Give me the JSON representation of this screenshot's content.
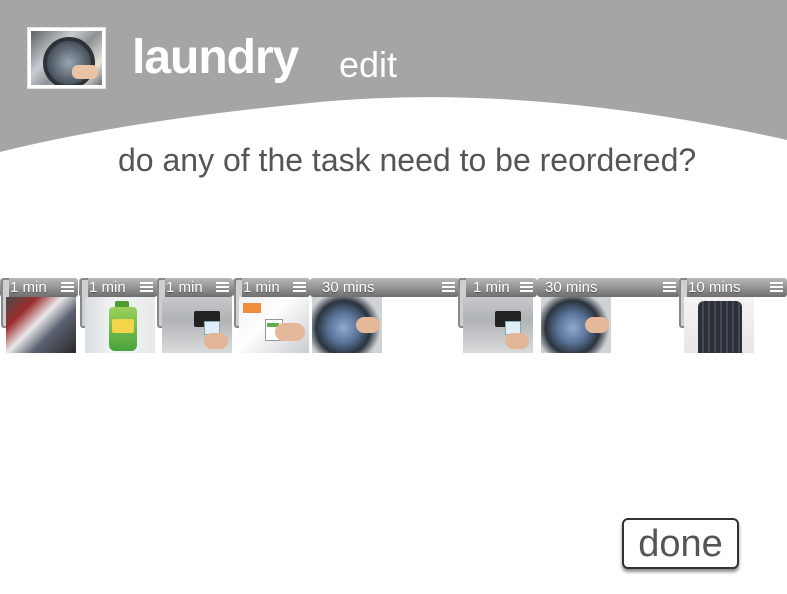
{
  "header": {
    "title": "laundry",
    "subtitle": "edit",
    "icon": "laundry-photo-icon",
    "band_color": "#a5a5a5"
  },
  "question": "do any of the task need to be reordered?",
  "tasks": [
    {
      "duration": "1 min",
      "image": "laundry-pile"
    },
    {
      "duration": "1 min",
      "image": "detergent-bottle"
    },
    {
      "duration": "1 min",
      "image": "machine-card-slot"
    },
    {
      "duration": "1 min",
      "image": "card-insert"
    },
    {
      "duration": "30 mins",
      "image": "washing-drum"
    },
    {
      "duration": "1 min",
      "image": "machine-card-slot"
    },
    {
      "duration": "30 mins",
      "image": "washing-drum"
    },
    {
      "duration": "10 mins",
      "image": "folded-shirt"
    }
  ],
  "done_label": "done"
}
